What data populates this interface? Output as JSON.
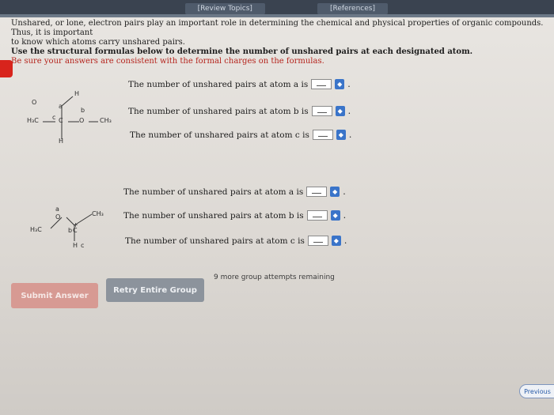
{
  "topbar": {
    "tab_review": "[Review Topics]",
    "tab_references": "[References]"
  },
  "intro": {
    "line1": "Unshared, or lone, electron pairs play an important role in determining the chemical and physical properties of organic compounds. Thus, it is important",
    "line2": "to know which atoms carry unshared pairs.",
    "line3": "Use the structural formulas below to determine the number of unshared pairs at each designated atom.",
    "line4": "Be sure your answers are consistent with the formal charges on the formulas."
  },
  "group1": {
    "questions": [
      {
        "prompt": "The number of unshared pairs at atom a is",
        "value": ""
      },
      {
        "prompt": "The number of unshared pairs at atom b is",
        "value": ""
      },
      {
        "prompt": "The number of unshared pairs at atom c is",
        "value": ""
      }
    ],
    "molecule": {
      "labels": {
        "h3c": "H₃C",
        "c": "C",
        "o": "O",
        "ch3": "CH₃",
        "h_bottom": "H",
        "h_top": "H",
        "a": "a",
        "b": "b",
        "c_label": "c",
        "o_top": "O"
      }
    }
  },
  "group2": {
    "questions": [
      {
        "prompt": "The number of unshared pairs at atom a is",
        "value": ""
      },
      {
        "prompt": "The number of unshared pairs at atom b is",
        "value": ""
      },
      {
        "prompt": "The number of unshared pairs at atom c is",
        "value": ""
      }
    ],
    "molecule": {
      "labels": {
        "h3c": "H₃C",
        "o": "O",
        "ch3": "CH₃",
        "c": "C",
        "h": "H",
        "a": "a",
        "b": "b",
        "c_label": "c",
        "plus": "+"
      }
    }
  },
  "actions": {
    "submit": "Submit Answer",
    "retry": "Retry Entire Group",
    "remaining": "9 more group attempts remaining",
    "previous": "Previous"
  },
  "colors": {
    "accent_red": "#d8241c",
    "spinner_blue": "#3a74c9"
  }
}
